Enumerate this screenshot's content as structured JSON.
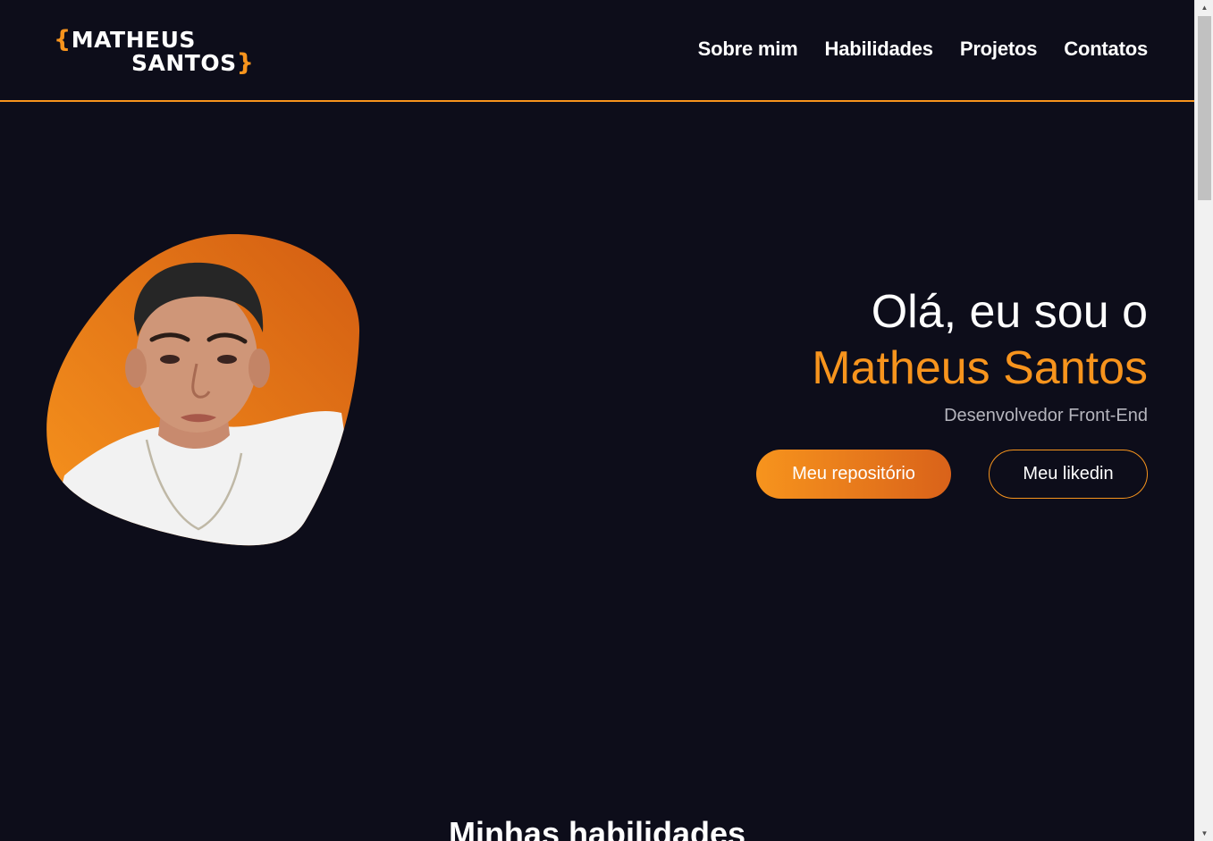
{
  "header": {
    "logo": {
      "open_brace": "{",
      "line1": "MATHEUS",
      "line2": "SANTOS",
      "close_brace": "}"
    },
    "nav": [
      {
        "label": "Sobre mim"
      },
      {
        "label": "Habilidades"
      },
      {
        "label": "Projetos"
      },
      {
        "label": "Contatos"
      }
    ]
  },
  "hero": {
    "greeting": "Olá, eu sou o",
    "name": "Matheus Santos",
    "role": "Desenvolvedor Front-End",
    "primary_button": "Meu repositório",
    "secondary_button": "Meu likedin"
  },
  "skills_section": {
    "title": "Minhas habilidades"
  },
  "colors": {
    "background": "#0d0d1a",
    "accent": "#f7941d",
    "accent_dark": "#d9621a",
    "text": "#ffffff",
    "muted": "#b5b5bd"
  }
}
